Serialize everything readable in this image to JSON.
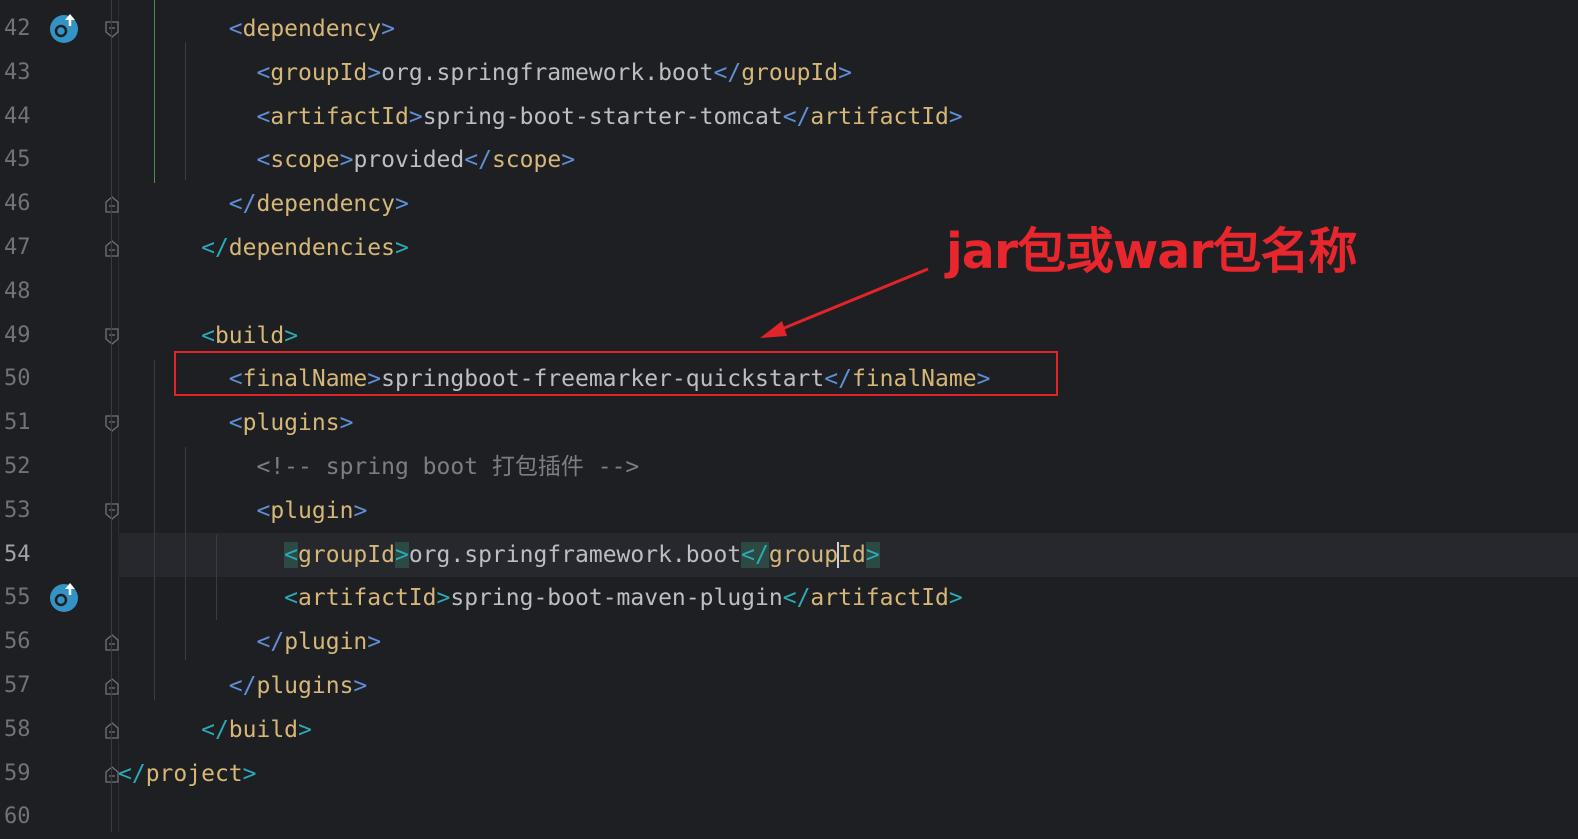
{
  "editor": {
    "lines": [
      {
        "num": "42",
        "indent": "        ",
        "tokens": [
          [
            "br2",
            "<"
          ],
          [
            "tag",
            "dependency"
          ],
          [
            "br2",
            ">"
          ]
        ]
      },
      {
        "num": "43",
        "indent": "          ",
        "tokens": [
          [
            "br2",
            "<"
          ],
          [
            "tag",
            "groupId"
          ],
          [
            "br2",
            ">"
          ],
          [
            "txt",
            "org.springframework.boot"
          ],
          [
            "br2",
            "</"
          ],
          [
            "tag",
            "groupId"
          ],
          [
            "br2",
            ">"
          ]
        ]
      },
      {
        "num": "44",
        "indent": "          ",
        "tokens": [
          [
            "br2",
            "<"
          ],
          [
            "tag",
            "artifactId"
          ],
          [
            "br2",
            ">"
          ],
          [
            "txt",
            "spring-boot-starter-tomcat"
          ],
          [
            "br2",
            "</"
          ],
          [
            "tag",
            "artifactId"
          ],
          [
            "br2",
            ">"
          ]
        ]
      },
      {
        "num": "45",
        "indent": "          ",
        "tokens": [
          [
            "br2",
            "<"
          ],
          [
            "tag",
            "scope"
          ],
          [
            "br2",
            ">"
          ],
          [
            "txt",
            "provided"
          ],
          [
            "br2",
            "</"
          ],
          [
            "tag",
            "scope"
          ],
          [
            "br2",
            ">"
          ]
        ]
      },
      {
        "num": "46",
        "indent": "        ",
        "tokens": [
          [
            "br2",
            "</"
          ],
          [
            "tag",
            "dependency"
          ],
          [
            "br2",
            ">"
          ]
        ]
      },
      {
        "num": "47",
        "indent": "      ",
        "tokens": [
          [
            "br",
            "</"
          ],
          [
            "tag",
            "dependencies"
          ],
          [
            "br",
            ">"
          ]
        ]
      },
      {
        "num": "48",
        "indent": "",
        "tokens": []
      },
      {
        "num": "49",
        "indent": "      ",
        "tokens": [
          [
            "br",
            "<"
          ],
          [
            "tag",
            "build"
          ],
          [
            "br",
            ">"
          ]
        ]
      },
      {
        "num": "50",
        "indent": "        ",
        "tokens": [
          [
            "br2",
            "<"
          ],
          [
            "tag",
            "finalName"
          ],
          [
            "br2",
            ">"
          ],
          [
            "txt",
            "springboot-freemarker-quickstart"
          ],
          [
            "br2",
            "</"
          ],
          [
            "tag",
            "finalName"
          ],
          [
            "br2",
            ">"
          ]
        ]
      },
      {
        "num": "51",
        "indent": "        ",
        "tokens": [
          [
            "br2",
            "<"
          ],
          [
            "tag",
            "plugins"
          ],
          [
            "br2",
            ">"
          ]
        ]
      },
      {
        "num": "52",
        "indent": "          ",
        "tokens": [
          [
            "cmt",
            "<!-- spring boot 打包插件 -->"
          ]
        ]
      },
      {
        "num": "53",
        "indent": "          ",
        "tokens": [
          [
            "br2",
            "<"
          ],
          [
            "tag",
            "plugin"
          ],
          [
            "br2",
            ">"
          ]
        ]
      },
      {
        "num": "54",
        "indent": "            ",
        "tokens": [
          [
            "br",
            "<"
          ],
          [
            "tag",
            "groupId"
          ],
          [
            "br",
            ">"
          ],
          [
            "txt",
            "org.springframework.boot"
          ],
          [
            "br",
            "</"
          ],
          [
            "tag",
            "groupId"
          ],
          [
            "br",
            ">"
          ]
        ]
      },
      {
        "num": "55",
        "indent": "            ",
        "tokens": [
          [
            "br",
            "<"
          ],
          [
            "tag",
            "artifactId"
          ],
          [
            "br",
            ">"
          ],
          [
            "txt",
            "spring-boot-maven-plugin"
          ],
          [
            "br",
            "</"
          ],
          [
            "tag",
            "artifactId"
          ],
          [
            "br",
            ">"
          ]
        ]
      },
      {
        "num": "56",
        "indent": "          ",
        "tokens": [
          [
            "br2",
            "</"
          ],
          [
            "tag",
            "plugin"
          ],
          [
            "br2",
            ">"
          ]
        ]
      },
      {
        "num": "57",
        "indent": "        ",
        "tokens": [
          [
            "br2",
            "</"
          ],
          [
            "tag",
            "plugins"
          ],
          [
            "br2",
            ">"
          ]
        ]
      },
      {
        "num": "58",
        "indent": "      ",
        "tokens": [
          [
            "br",
            "</"
          ],
          [
            "tag",
            "build"
          ],
          [
            "br",
            ">"
          ]
        ]
      },
      {
        "num": "59",
        "indent": "",
        "tokens": [
          [
            "br",
            "</"
          ],
          [
            "tag",
            "project"
          ],
          [
            "br",
            ">"
          ]
        ]
      },
      {
        "num": "60",
        "indent": "",
        "tokens": []
      }
    ],
    "current_line": "54"
  },
  "annotation": {
    "text": "jar包或war包名称",
    "color": "#e8262d"
  },
  "colors": {
    "background": "#1e1f22",
    "tag": "#d5b778",
    "bracket": "#5f8fd9",
    "text": "#bcbec4",
    "highlight_box": "#e0242a"
  },
  "gutter_icons": [
    {
      "line": "42",
      "icon": "override-method-icon"
    },
    {
      "line": "55",
      "icon": "override-method-icon"
    }
  ]
}
